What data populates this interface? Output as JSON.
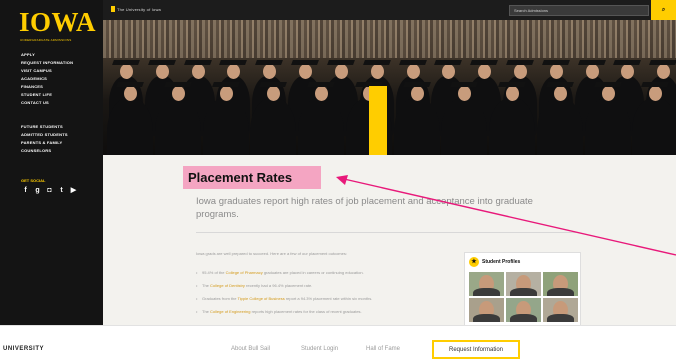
{
  "sidebar": {
    "logo": "IOWA",
    "logo_sub": "UNDERGRADUATE ADMISSIONS",
    "nav_primary": [
      "APPLY",
      "REQUEST INFORMATION",
      "VISIT CAMPUS",
      "ACADEMICS",
      "FINANCES",
      "STUDENT LIFE",
      "CONTACT US"
    ],
    "nav_secondary": [
      "FUTURE STUDENTS",
      "ADMITTED STUDENTS",
      "PARENTS & FAMILY",
      "COUNSELORS"
    ],
    "social_label": "GET SOCIAL",
    "social_icons": [
      "facebook-icon",
      "google-plus-icon",
      "instagram-icon",
      "twitter-icon",
      "youtube-icon"
    ]
  },
  "topbar": {
    "university": "The University of Iowa",
    "search_placeholder": "Search Admissions",
    "search_button_icon": "search-icon"
  },
  "main": {
    "title": "Placement Rates",
    "subtitle": "Iowa graduates report high rates of job placement and acceptance into graduate programs.",
    "intro": "Iowa grads are well prepared to succeed. Here are a few of our placement outcomes:",
    "bullets": [
      {
        "pre": "95.4% of the ",
        "link": "College of Pharmacy",
        "post": " graduates are placed in careers or continuing education."
      },
      {
        "pre": "The ",
        "link": "College of Dentistry",
        "post": " recently had a 96.4% placement rate."
      },
      {
        "pre": "Graduates from the ",
        "link": "Tippie College of Business",
        "post": " report a 94.3% placement rate within six months."
      },
      {
        "pre": "The ",
        "link": "College of Engineering",
        "post": " reports high placement rates for the class of recent graduates."
      }
    ]
  },
  "profiles": {
    "title": "Student Profiles",
    "icon": "star-icon",
    "count": 6
  },
  "bottombar": {
    "brand": "UNIVERSITY",
    "links": [
      "About Bull Sail",
      "Student Login",
      "Hall of Fame"
    ],
    "cta": "Request Information"
  },
  "colors": {
    "gold": "#ffcd00",
    "black": "#141414",
    "annotation_pink": "#e8197a",
    "highlight_pink": "#f4a5c2"
  }
}
